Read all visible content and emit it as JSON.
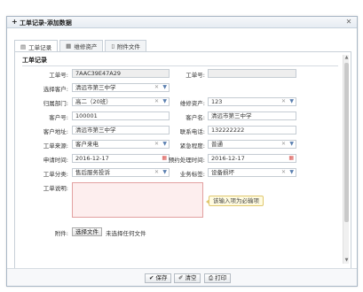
{
  "window": {
    "title": "工单记录-添加数据",
    "close_glyph": "✕"
  },
  "tabs": [
    {
      "label": "工单记录",
      "icon": "list-icon"
    },
    {
      "label": "维修资产",
      "icon": "table-icon"
    },
    {
      "label": "附件文件",
      "icon": "file-icon"
    }
  ],
  "section": {
    "title": "工单记录"
  },
  "form": {
    "work_order_no_label": "工单号:",
    "work_order_no_value": "7AAC39E47A29",
    "work_order_no2_label": "工单号:",
    "work_order_no2_value": "",
    "customer_label": "选择客户:",
    "customer_value": "清远市第三中学",
    "asset_label": "维修资产:",
    "asset_value": "123",
    "dept_label": "归属部门:",
    "dept_value": "高二（20班）",
    "customer_no_label": "客户号:",
    "customer_no_value": "100001",
    "customer_name_label": "客户名:",
    "customer_name_value": "清远市第三中学",
    "customer_addr_label": "客户地址:",
    "customer_addr_value": "清远市第三中学",
    "contact_phone_label": "联系电话:",
    "contact_phone_value": "132222222",
    "source_label": "工单来源:",
    "source_value": "客户来电",
    "urgency_label": "紧急程度:",
    "urgency_value": "普通",
    "apply_time_label": "申请时间:",
    "apply_time_value": "2016-12-17",
    "planned_time_label": "预约处理时间:",
    "planned_time_value": "2016-12-17",
    "category_label": "工单分类:",
    "category_value": "售后服务投诉",
    "business_label": "业务标签:",
    "business_value": "设备损坏",
    "description_label": "工单说明:",
    "description_tip": "该输入项为必输项",
    "attachment_label": "附件:",
    "choose_file_label": "选择文件",
    "file_status": "未选择任何文件"
  },
  "footer": {
    "save_label": "保存",
    "clear_label": "清空",
    "print_label": "打印"
  },
  "colors": {
    "required_bg": "#fdeeee",
    "required_border": "#e2a0a0",
    "tip_bg": "#fffbe0"
  }
}
